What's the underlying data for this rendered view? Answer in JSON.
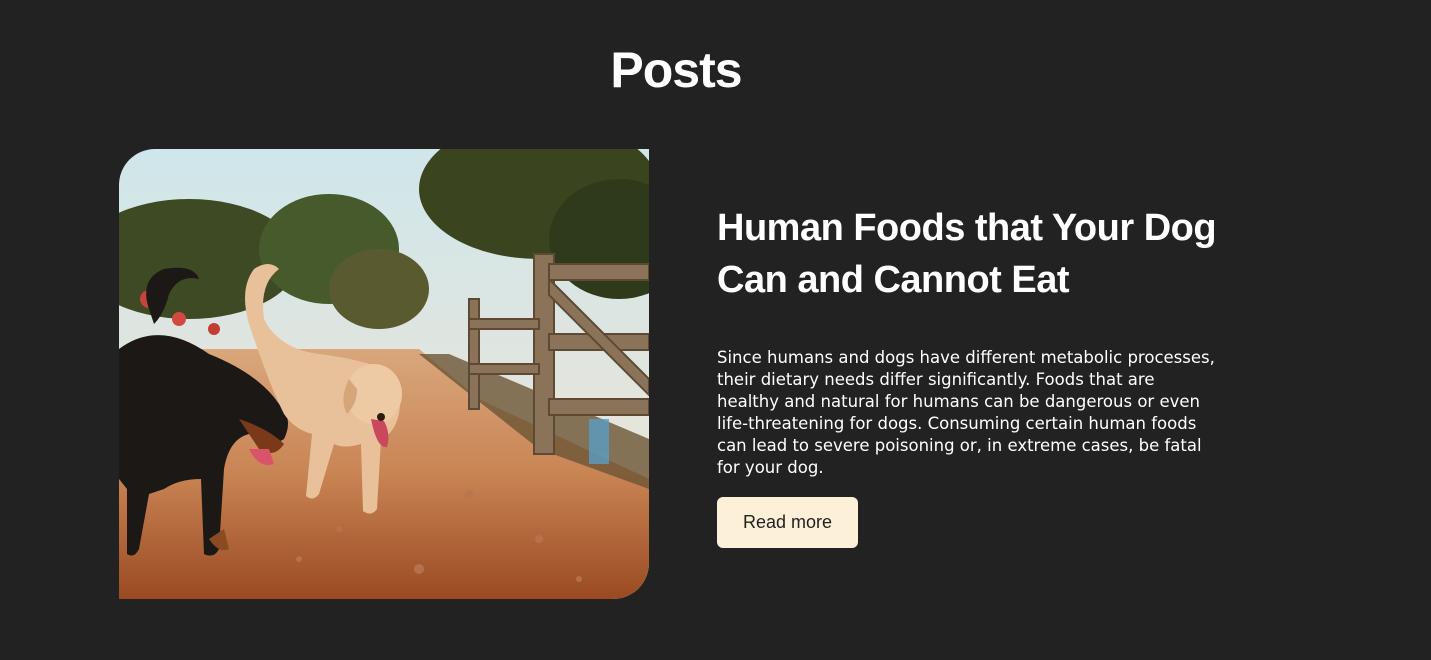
{
  "section": {
    "title": "Posts"
  },
  "post": {
    "image_alt": "Two dogs walking on a dirt path beside a wooden fence",
    "title": "Human Foods that Your Dog Can and Cannot Eat",
    "excerpt": "Since humans and dogs have different metabolic processes, their dietary needs differ significantly. Foods that are healthy and natural for humans can be dangerous or even life-threatening for dogs. Consuming certain human foods can lead to severe poisoning or, in extreme cases, be fatal for your dog.",
    "read_more_label": "Read more"
  },
  "colors": {
    "page_background": "#222222",
    "text": "#ffffff",
    "button_background": "#fdf0d8",
    "button_text": "#222222"
  }
}
